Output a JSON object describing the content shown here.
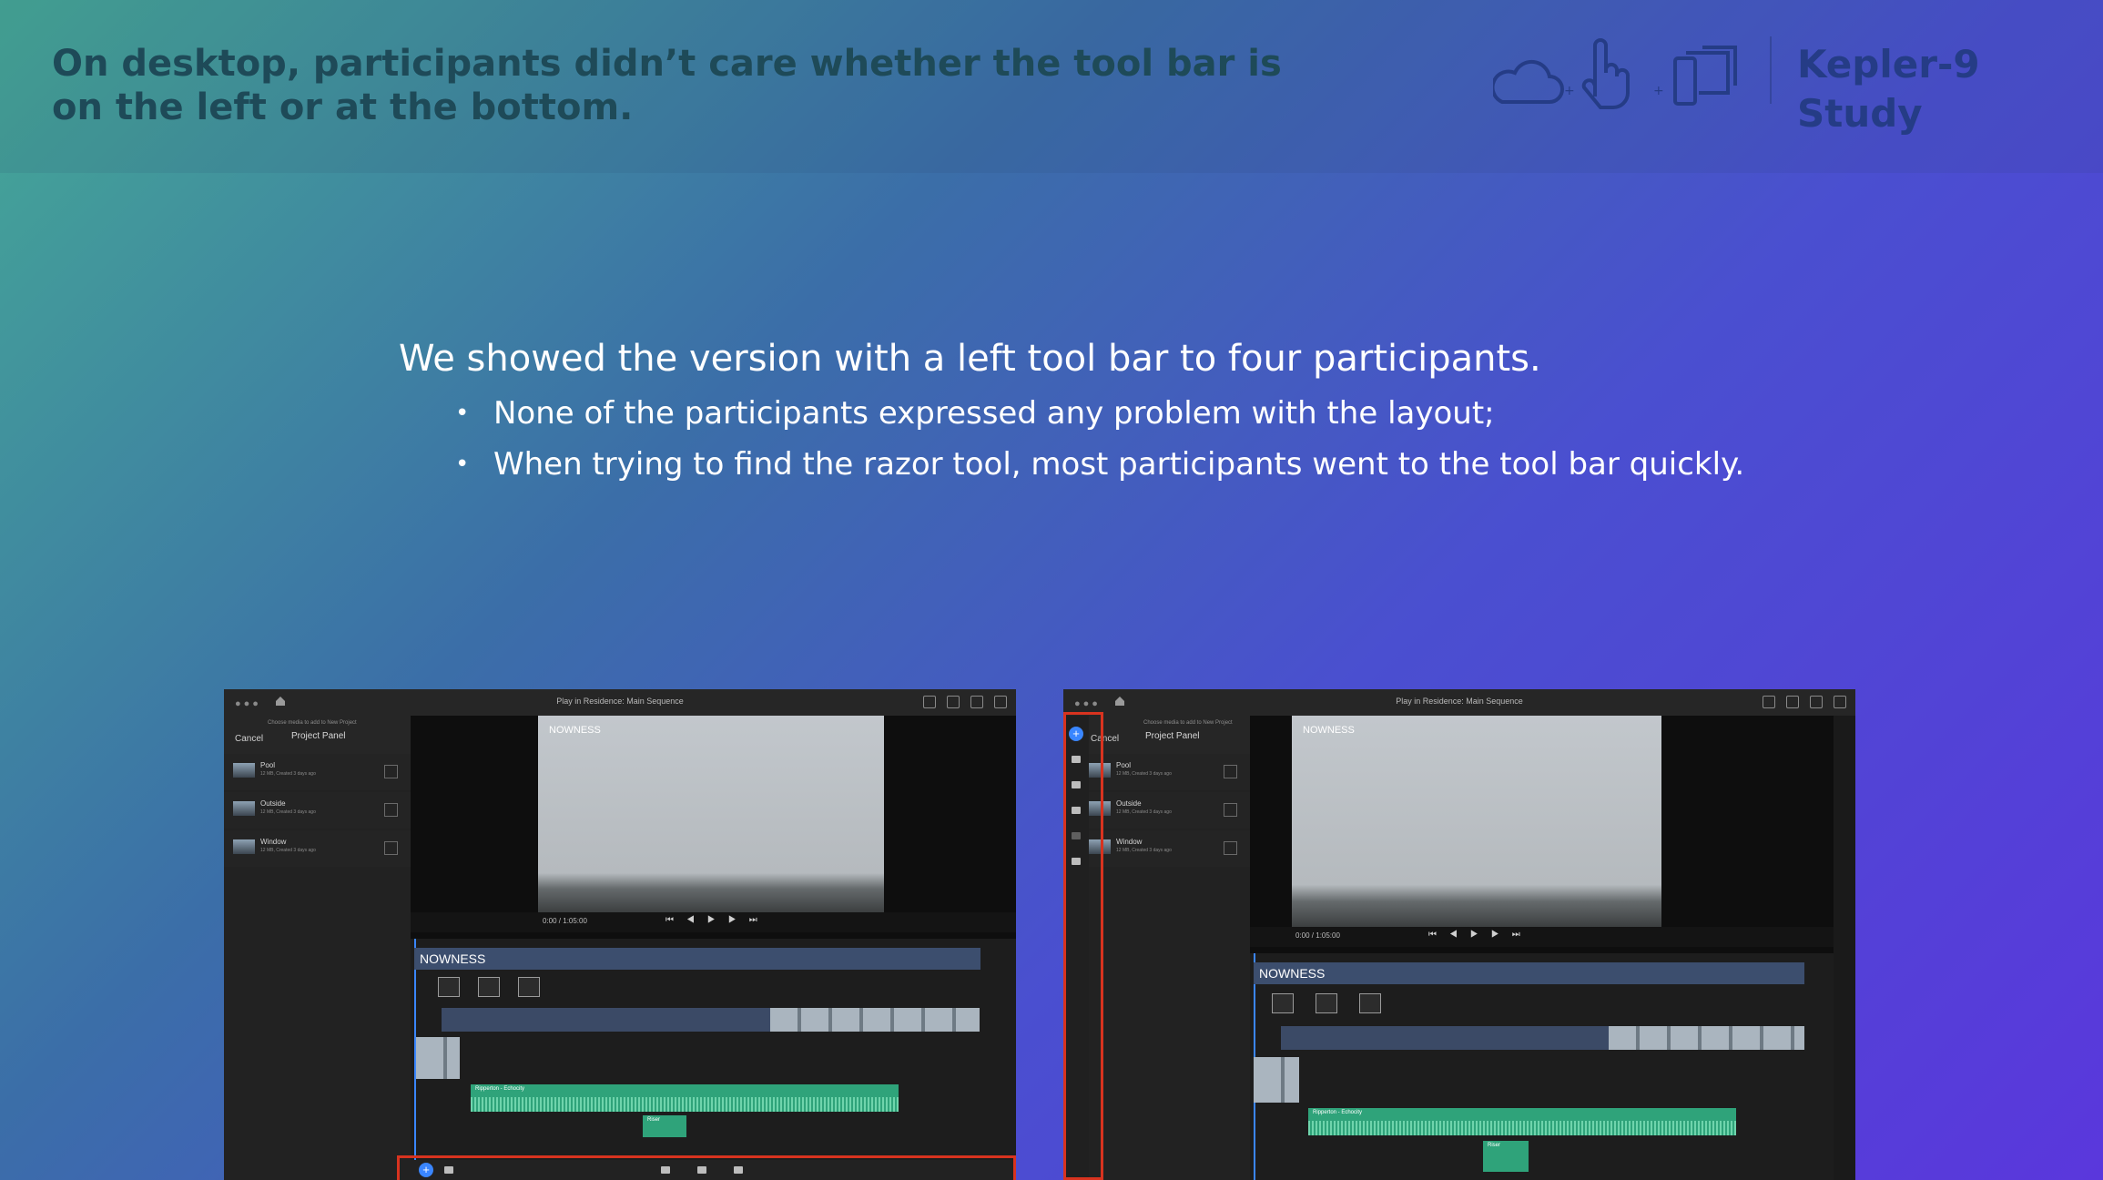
{
  "header": {
    "title": "On desktop, participants didn’t care whether the tool bar is on the left or at the bottom.",
    "brand": "Kepler-9 Study",
    "icons": [
      "cloud-icon",
      "touch-hand-icon",
      "devices-icon"
    ]
  },
  "body": {
    "lead": "We showed the version with a left tool bar to four participants.",
    "bullets": [
      "None of the participants expressed any problem with the layout;",
      "When trying to find the razor tool, most participants went to the tool bar quickly."
    ]
  },
  "app": {
    "doc_title": "Play in Residence: Main Sequence",
    "cancel": "Cancel",
    "choose_media": "Choose media to add to New Project",
    "project_panel": "Project Panel",
    "media": [
      {
        "name": "Pool",
        "meta": "12 MB, Created 3 days ago"
      },
      {
        "name": "Outside",
        "meta": "12 MB, Created 3 days ago"
      },
      {
        "name": "Window",
        "meta": "12 MB, Created 3 days ago"
      }
    ],
    "video_title": "NOWNESS",
    "timecode": "0:00 / 1:05:00",
    "track_title": "NOWNESS",
    "audio_clip": "Ripperton - Echocity",
    "audio_clip_2": "Riser",
    "tooltip": "x: 492 y: 33 width: 178 height: 52"
  },
  "colors": {
    "title_text": "#1e4a58",
    "brand_text": "#253c86",
    "highlight": "#d8331f",
    "audio": "#2fa37a",
    "accent": "#3a86ff"
  }
}
